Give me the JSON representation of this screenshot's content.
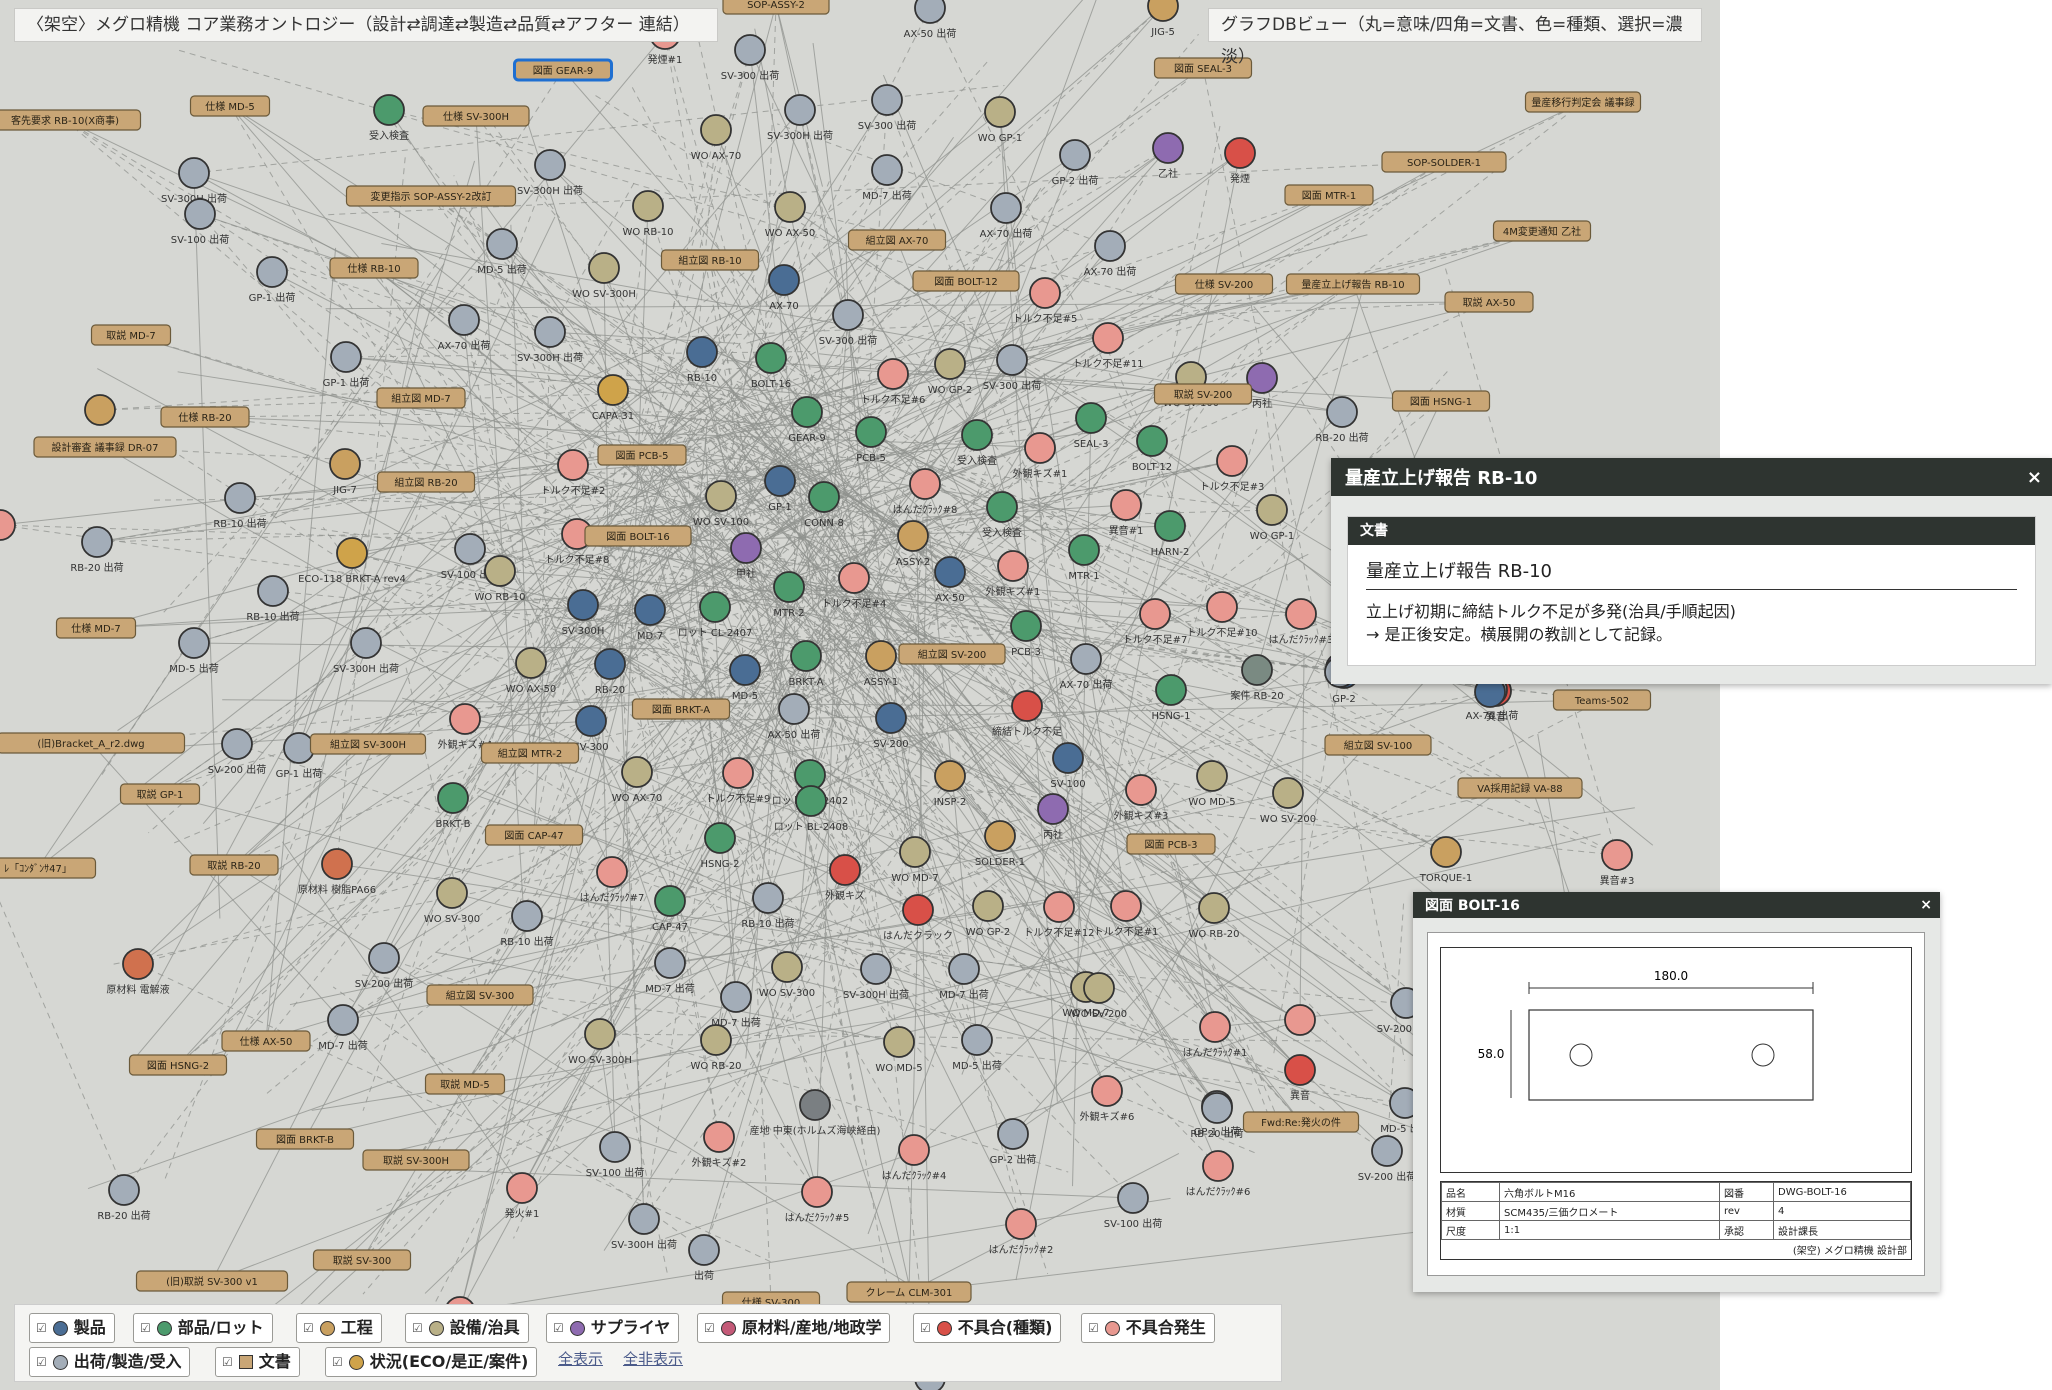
{
  "title": "〈架空〉メグロ精機 コア業務オントロジー（設計⇄調達⇄製造⇄品質⇄アフター 連結）",
  "view_title": "グラフDBビュー（丸=意味/四角=文書、色=種類、選択=濃淡）",
  "colors": {
    "product": "#4a6d94",
    "part": "#4c9a6c",
    "process": "#c9a060",
    "equip": "#b9b087",
    "supplier": "#8e6bb0",
    "material": "#d0714e",
    "defect_type": "#d85048",
    "defect": "#e89890",
    "shipment": "#a3adb8",
    "doc": "#c9a676",
    "status": "#cfa34a"
  },
  "legend": {
    "items": [
      {
        "label": "製品",
        "color": "#4a6d94",
        "shape": "dot"
      },
      {
        "label": "部品/ロット",
        "color": "#4c9a6c",
        "shape": "dot"
      },
      {
        "label": "工程",
        "color": "#c9a060",
        "shape": "dot"
      },
      {
        "label": "設備/治具",
        "color": "#b9b087",
        "shape": "dot"
      },
      {
        "label": "サプライヤ",
        "color": "#8e6bb0",
        "shape": "dot"
      },
      {
        "label": "原材料/産地/地政学",
        "color": "#c45a78",
        "shape": "dot"
      },
      {
        "label": "不具合(種類)",
        "color": "#d85048",
        "shape": "dot"
      },
      {
        "label": "不具合発生",
        "color": "#e89890",
        "shape": "dot"
      },
      {
        "label": "出荷/製造/受入",
        "color": "#a3adb8",
        "shape": "dot"
      },
      {
        "label": "文書",
        "color": "#c9a676",
        "shape": "sq"
      },
      {
        "label": "状況(ECO/是正/案件)",
        "color": "#cfa34a",
        "shape": "dot"
      }
    ],
    "checkbox_glyph": "☑",
    "show_all": "全表示",
    "hide_all": "全非表示"
  },
  "nodes": [
    [
      "c",
      "発煙#1",
      "#e89890"
    ],
    [
      "c",
      "SV-300 出荷",
      "#a3adb8"
    ],
    [
      "c",
      "AX-50 出荷",
      "#a3adb8"
    ],
    [
      "c",
      "JIG-5",
      "#c9a060"
    ],
    [
      "c",
      "SV-300H 出荷",
      "#a3adb8"
    ],
    [
      "c",
      "SV-300 出荷",
      "#a3adb8"
    ],
    [
      "c",
      "WO GP-1",
      "#b9b087"
    ],
    [
      "c",
      "受入検査",
      "#4c9a6c"
    ],
    [
      "c",
      "WO AX-70",
      "#b9b087"
    ],
    [
      "c",
      "乙社",
      "#8e6bb0"
    ],
    [
      "c",
      "発煙",
      "#d85048"
    ],
    [
      "c",
      "SV-300H 出荷",
      "#a3adb8"
    ],
    [
      "c",
      "MD-7 出荷",
      "#a3adb8"
    ],
    [
      "c",
      "GP-2 出荷",
      "#a3adb8"
    ],
    [
      "c",
      "WO RB-10",
      "#b9b087"
    ],
    [
      "c",
      "AX-70 出荷",
      "#a3adb8"
    ],
    [
      "c",
      "SV-300H 出荷",
      "#a3adb8"
    ],
    [
      "c",
      "SV-100 出荷",
      "#a3adb8"
    ],
    [
      "c",
      "WO AX-50",
      "#b9b087"
    ],
    [
      "c",
      "MD-5 出荷",
      "#a3adb8"
    ],
    [
      "c",
      "WO SV-300H",
      "#b9b087"
    ],
    [
      "c",
      "AX-70",
      "#4a6d94"
    ],
    [
      "c",
      "AX-70 出荷",
      "#a3adb8"
    ],
    [
      "c",
      "GP-1 出荷",
      "#a3adb8"
    ],
    [
      "c",
      "トルク不足#5",
      "#e89890"
    ],
    [
      "c",
      "AX-70 出荷",
      "#a3adb8"
    ],
    [
      "c",
      "SV-300H 出荷",
      "#a3adb8"
    ],
    [
      "c",
      "SV-300 出荷",
      "#a3adb8"
    ],
    [
      "c",
      "RB-10",
      "#4a6d94"
    ],
    [
      "c",
      "BOLT-16",
      "#4c9a6c"
    ],
    [
      "c",
      "トルク不足#11",
      "#e89890"
    ],
    [
      "c",
      "WO SV-100",
      "#b9b087"
    ],
    [
      "c",
      "丙社",
      "#8e6bb0"
    ],
    [
      "c",
      "RB-20 出荷",
      "#a3adb8"
    ],
    [
      "c",
      "トルク不足#6",
      "#e89890"
    ],
    [
      "c",
      "WO GP-2",
      "#b9b087"
    ],
    [
      "c",
      "SV-300 出荷",
      "#a3adb8"
    ],
    [
      "c",
      "CAPA-31",
      "#cfa34a"
    ],
    [
      "c",
      "GP-1 出荷",
      "#a3adb8"
    ],
    [
      "c",
      "JIG-7",
      "#c9a060"
    ],
    [
      "c",
      "GEAR-9",
      "#4c9a6c"
    ],
    [
      "c",
      "PCB-5",
      "#4c9a6c"
    ],
    [
      "c",
      "受入検査",
      "#4c9a6c"
    ],
    [
      "c",
      "SEAL-3",
      "#4c9a6c"
    ],
    [
      "c",
      "BOLT-12",
      "#4c9a6c"
    ],
    [
      "c",
      "トルク不足#2",
      "#e89890"
    ],
    [
      "c",
      "外観キズ#1",
      "#e89890"
    ],
    [
      "c",
      "トルク不足#3",
      "#e89890"
    ],
    [
      "c",
      "RB-10 出荷",
      "#a3adb8"
    ],
    [
      "c",
      "GP-1",
      "#4a6d94"
    ],
    [
      "c",
      "CONN-8",
      "#4c9a6c"
    ],
    [
      "c",
      "はんだｸﾗｯｸ#8",
      "#e89890"
    ],
    [
      "c",
      "異音#1",
      "#e89890"
    ],
    [
      "c",
      "HARN-2",
      "#4c9a6c"
    ],
    [
      "c",
      "RB-20 出荷",
      "#a3adb8"
    ],
    [
      "c",
      "ECO-118 BRKT-A rev4",
      "#cfa34a"
    ],
    [
      "c",
      "SV-100 出荷",
      "#a3adb8"
    ],
    [
      "c",
      "WO SV-100",
      "#b9b087"
    ],
    [
      "c",
      "トルク不足#8",
      "#e89890"
    ],
    [
      "c",
      "甲社",
      "#8e6bb0"
    ],
    [
      "c",
      "ASSY-2",
      "#c9a060"
    ],
    [
      "c",
      "受入検査",
      "#4c9a6c"
    ],
    [
      "c",
      "WO GP-1",
      "#b9b087"
    ],
    [
      "c",
      "RB-10 出荷",
      "#a3adb8"
    ],
    [
      "c",
      "WO RB-10",
      "#b9b087"
    ],
    [
      "c",
      "SV-300H",
      "#4a6d94"
    ],
    [
      "c",
      "MD-7",
      "#4a6d94"
    ],
    [
      "c",
      "ロット CL-2407",
      "#4c9a6c"
    ],
    [
      "c",
      "MTR-2",
      "#4c9a6c"
    ],
    [
      "c",
      "トルク不足#4",
      "#e89890"
    ],
    [
      "c",
      "AX-50",
      "#4a6d94"
    ],
    [
      "c",
      "外観キズ#1",
      "#e89890"
    ],
    [
      "c",
      "MTR-1",
      "#4c9a6c"
    ],
    [
      "c",
      "トルク不足#7",
      "#e89890"
    ],
    [
      "c",
      "トルク不足#10",
      "#e89890"
    ],
    [
      "c",
      "はんだｸﾗｯｸ#3",
      "#e89890"
    ],
    [
      "c",
      "MD-5 出荷",
      "#a3adb8"
    ],
    [
      "c",
      "SV-300H 出荷",
      "#a3adb8"
    ],
    [
      "c",
      "WO AX-50",
      "#b9b087"
    ],
    [
      "c",
      "RB-20",
      "#4a6d94"
    ],
    [
      "c",
      "BRKT-A",
      "#4c9a6c"
    ],
    [
      "c",
      "ASSY-1",
      "#c9a060"
    ],
    [
      "c",
      "MD-5",
      "#4a6d94"
    ],
    [
      "c",
      "PCB-3",
      "#4c9a6c"
    ],
    [
      "c",
      "AX-70 出荷",
      "#a3adb8"
    ],
    [
      "c",
      "HSNG-1",
      "#4c9a6c"
    ],
    [
      "c",
      "案件 RB-20",
      "#7a8a82"
    ],
    [
      "c",
      "GP-2",
      "#4a6d94"
    ],
    [
      "c",
      "異音",
      "#d85048"
    ],
    [
      "c",
      "外観キズ#4",
      "#e89890"
    ],
    [
      "c",
      "SV-300",
      "#4a6d94"
    ],
    [
      "c",
      "AX-50 出荷",
      "#a3adb8"
    ],
    [
      "c",
      "締結トルク不足",
      "#d85048"
    ],
    [
      "c",
      "SV-200",
      "#4a6d94"
    ],
    [
      "c",
      "SV-200 出荷",
      "#a3adb8"
    ],
    [
      "c",
      "GP-1 出荷",
      "#a3adb8"
    ],
    [
      "c",
      "BRKT-B",
      "#4c9a6c"
    ],
    [
      "c",
      "WO AX-70",
      "#b9b087"
    ],
    [
      "c",
      "トルク不足#9",
      "#e89890"
    ],
    [
      "c",
      "ロット GR-2402",
      "#4c9a6c"
    ],
    [
      "c",
      "INSP-2",
      "#c9a060"
    ],
    [
      "c",
      "SV-100",
      "#4a6d94"
    ],
    [
      "c",
      "外観キズ#3",
      "#e89890"
    ],
    [
      "c",
      "WO MD-5",
      "#b9b087"
    ],
    [
      "c",
      "WO SV-200",
      "#b9b087"
    ],
    [
      "c",
      "ロット BL-2408",
      "#4c9a6c"
    ],
    [
      "c",
      "丙社",
      "#8e6bb0"
    ],
    [
      "c",
      "HSNG-2",
      "#4c9a6c"
    ],
    [
      "c",
      "WO MD-7",
      "#b9b087"
    ],
    [
      "c",
      "外観キズ",
      "#d85048"
    ],
    [
      "c",
      "SOLDER-1",
      "#c9a060"
    ],
    [
      "c",
      "TORQUE-1",
      "#c9a060"
    ],
    [
      "c",
      "異音#3",
      "#e89890"
    ],
    [
      "c",
      "原材料 樹脂PA66",
      "#d0714e"
    ],
    [
      "c",
      "WO SV-300",
      "#b9b087"
    ],
    [
      "c",
      "RB-10 出荷",
      "#a3adb8"
    ],
    [
      "c",
      "はんだｸﾗｯｸ#7",
      "#e89890"
    ],
    [
      "c",
      "CAP-47",
      "#4c9a6c"
    ],
    [
      "c",
      "RB-10 出荷",
      "#a3adb8"
    ],
    [
      "c",
      "はんだクラック",
      "#d85048"
    ],
    [
      "c",
      "WO GP-2",
      "#b9b087"
    ],
    [
      "c",
      "トルク不足#12",
      "#e89890"
    ],
    [
      "c",
      "トルク不足#1",
      "#e89890"
    ],
    [
      "c",
      "WO RB-20",
      "#b9b087"
    ],
    [
      "c",
      "原材料 電解液",
      "#d0714e"
    ],
    [
      "c",
      "SV-200 出荷",
      "#a3adb8"
    ],
    [
      "c",
      "MD-7 出荷",
      "#a3adb8"
    ],
    [
      "c",
      "WO SV-300",
      "#b9b087"
    ],
    [
      "c",
      "SV-300H 出荷",
      "#a3adb8"
    ],
    [
      "c",
      "MD-7 出荷",
      "#a3adb8"
    ],
    [
      "c",
      "WO MD-7",
      "#b9b087"
    ],
    [
      "c",
      "はんだｸﾗｯｸ#1",
      "#e89890"
    ],
    [
      "c",
      "MD-7 出荷",
      "#a3adb8"
    ],
    [
      "c",
      "WO SV-200",
      "#b9b087"
    ],
    [
      "c",
      "MD-7 出荷",
      "#a3adb8"
    ],
    [
      "c",
      "WO SV-300H",
      "#b9b087"
    ],
    [
      "c",
      "WO RB-20",
      "#b9b087"
    ],
    [
      "c",
      "WO MD-5",
      "#b9b087"
    ],
    [
      "c",
      "MD-5 出荷",
      "#a3adb8"
    ],
    [
      "c",
      "外観キズ#6",
      "#e89890"
    ],
    [
      "c",
      "産地 中東(ホルムズ海峡経由)",
      "#7a7f82"
    ],
    [
      "c",
      "RB-20 出荷",
      "#a3adb8"
    ],
    [
      "c",
      "発火#1",
      "#e89890"
    ],
    [
      "c",
      "SV-100 出荷",
      "#a3adb8"
    ],
    [
      "c",
      "外観キズ#2",
      "#e89890"
    ],
    [
      "c",
      "はんだｸﾗｯｸ#4",
      "#e89890"
    ],
    [
      "c",
      "GP-2 出荷",
      "#a3adb8"
    ],
    [
      "c",
      "SV-200 出荷",
      "#a3adb8"
    ],
    [
      "c",
      "はんだｸﾗｯｸ#6",
      "#e89890"
    ],
    [
      "c",
      "はんだｸﾗｯｸ#5",
      "#e89890"
    ],
    [
      "c",
      "はんだｸﾗｯｸ#2",
      "#e89890"
    ],
    [
      "c",
      "SV-100 出荷",
      "#a3adb8"
    ],
    [
      "c",
      "SV-300H 出荷",
      "#a3adb8"
    ],
    [
      "c",
      "出荷",
      "#a3adb8"
    ],
    [
      "c",
      "SV-200 出荷",
      "#a3adb8"
    ],
    [
      "c",
      "MD-5 出荷",
      "#a3adb8"
    ],
    [
      "c",
      "GP-1 出荷",
      "#a3adb8"
    ],
    [
      "c",
      "RB-20 出荷",
      "#a3adb8"
    ],
    [
      "c",
      "AX-70 出荷",
      "#a3adb8"
    ],
    [
      "c",
      "",
      "#8e6bb0"
    ],
    [
      "c",
      "",
      "#c9a060"
    ],
    [
      "c",
      "",
      "#e89890"
    ],
    [
      "c",
      "",
      "#e89890"
    ],
    [
      "c",
      "異音",
      "#d85048"
    ],
    [
      "c",
      "",
      "#4a6d94"
    ],
    [
      "c",
      "",
      "#a3adb8"
    ],
    [
      "c",
      "",
      "#a3adb8"
    ],
    [
      "c",
      "",
      "#e89890"
    ],
    [
      "c",
      "",
      "#e89890"
    ],
    [
      "c",
      "",
      "#a3adb8"
    ]
  ],
  "docs": [
    "SOP-ASSY-2",
    "図面 GEAR-9",
    "図面 SEAL-3",
    "仕様 MD-5",
    "客先要求 RB-10(X商事)",
    "仕様 SV-300H",
    "量産移行判定会 議事録",
    "変更指示 SOP-ASSY-2改訂",
    "SOP-SOLDER-1",
    "図面 MTR-1",
    "仕様 RB-10",
    "組立図 AX-70",
    "組立図 RB-10",
    "4M変更通知 乙社",
    "図面 BOLT-12",
    "仕様 SV-200",
    "量産立上げ報告 RB-10",
    "取説 AX-50",
    "取説 MD-7",
    "組立図 MD-7",
    "取説 SV-200",
    "仕様 RB-20",
    "図面 HSNG-1",
    "設計審査 議事録 DR-07",
    "図面 PCB-5",
    "組立図 RB-20",
    "図面 BOLT-16",
    "仕様 MD-7",
    "組立図 SV-200",
    "図面 BRKT-A",
    "Teams-502",
    "(旧)Bracket_A_r2.dwg",
    "組立図 SV-300H",
    "組立図 MTR-2",
    "組立図 SV-100",
    "取説 GP-1",
    "VA採用記録 VA-88",
    "図面 CAP-47",
    "図面 PCB-3",
    "ﾚ「ｺﾝﾀﾞﾝｻ47」",
    "取説 RB-20",
    "組立図 SV-300",
    "仕様 AX-50",
    "図面 HSNG-2",
    "取説 MD-5",
    "Fwd:Re:発火の件",
    "図面 BRKT-B",
    "取説 SV-300H",
    "取説 SV-300",
    "(旧)取説 SV-300 v1",
    "クレーム CLM-301",
    "仕様 SV-300"
  ],
  "popup_report": {
    "header": "量産立上げ報告 RB-10",
    "close": "×",
    "section": "文書",
    "doc_title": "量産立上げ報告 RB-10",
    "doc_body": "立上げ初期に締結トルク不足が多発(治具/手順起因)\n→ 是正後安定。横展開の教訓として記録。"
  },
  "popup_drawing": {
    "header": "図面 BOLT-16",
    "close": "×",
    "dim_width": "180.0",
    "dim_height": "58.0",
    "titleblock": [
      [
        "品名",
        "六角ボルトM16",
        "図番",
        "DWG-BOLT-16"
      ],
      [
        "材質",
        "SCM435/三価クロメート",
        "rev",
        "4"
      ],
      [
        "尺度",
        "1:1",
        "承認",
        "設計課長"
      ]
    ],
    "footer": "(架空) メグロ精機 設計部"
  }
}
